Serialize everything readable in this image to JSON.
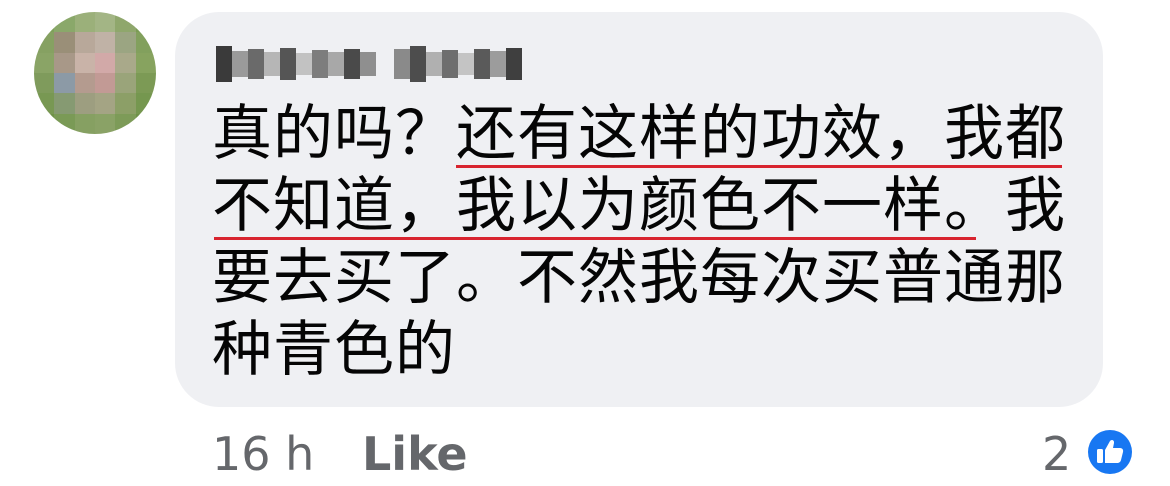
{
  "comment": {
    "lines": [
      "真的吗？还有这样的功效，我都",
      "不知道，我以为颜色不一样。我",
      "要去买了。不然我每次买普通那",
      "种青色的"
    ]
  },
  "footer": {
    "time": "16 h",
    "like_label": "Like",
    "reaction_count": "2",
    "reaction_icon": "thumbs-up-icon"
  },
  "colors": {
    "bubble": "#eff0f3",
    "secondary_text": "#65676b",
    "underline": "#d8242f",
    "like_blue": "#1877f2"
  }
}
